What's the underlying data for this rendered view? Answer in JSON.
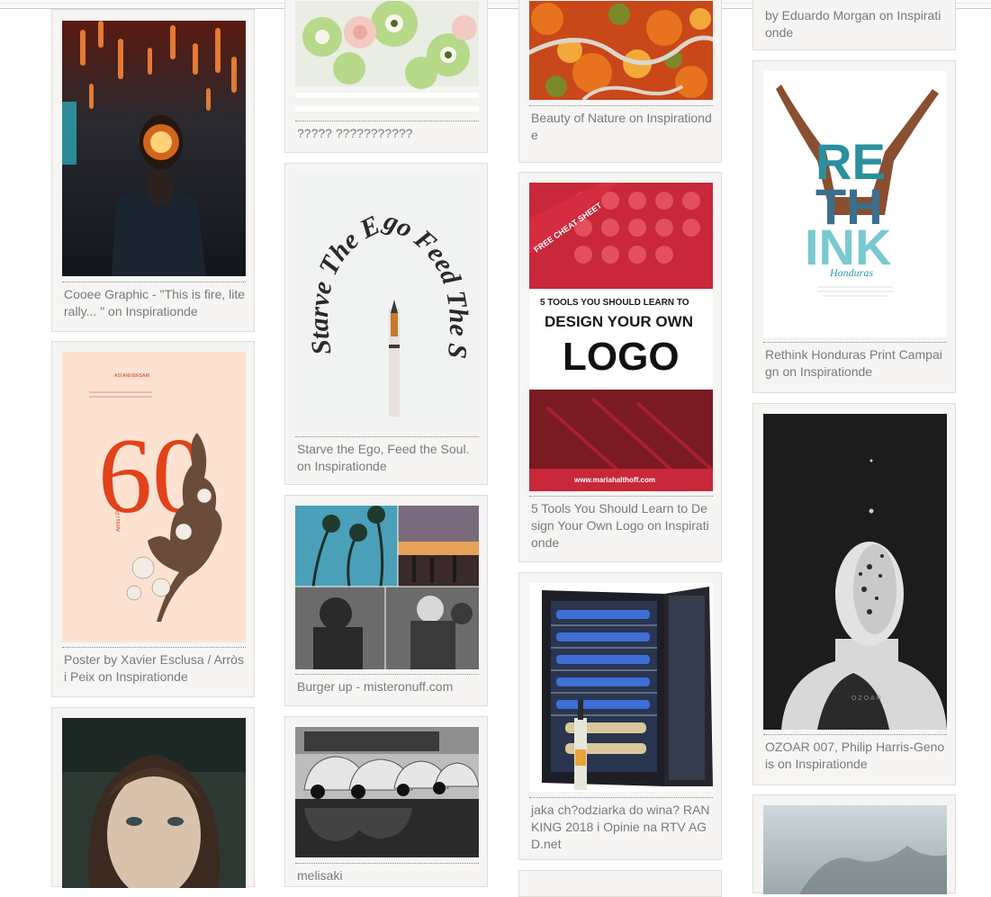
{
  "pins": {
    "c1": [
      {
        "caption": "Cooee Graphic - \"This is fire, literally... \" on Inspirationde"
      },
      {
        "caption": "Poster by Xavier Esclusa / Arròs i Peix on Inspirationde"
      },
      {
        "caption": ""
      }
    ],
    "c2": [
      {
        "caption": "????? ???????????"
      },
      {
        "caption": "Starve the Ego, Feed the Soul. on Inspirationde"
      },
      {
        "caption": "Burger up - misteronuff.com"
      },
      {
        "caption": "melisaki"
      }
    ],
    "c3": [
      {
        "caption": "Beauty of Nature on Inspirationde"
      },
      {
        "caption": "5 Tools You Should Learn to Design Your Own Logo on Inspirationde"
      },
      {
        "caption": "jaka ch?odziarka do wina? RANKING 2018 i Opinie na RTV AGD.net"
      }
    ],
    "c4": [
      {
        "caption": "by Eduardo Morgan on Inspirationde"
      },
      {
        "caption": "Rethink Honduras Print Campaign on Inspirationde"
      },
      {
        "caption": "OZOAR 007, Philip Harris-Genois on Inspirationde"
      }
    ]
  },
  "art": {
    "poster_number": "60",
    "poster_small_text": "ASÍ ANIVERSARI",
    "rethink_letters": [
      "RE",
      "TH",
      "INK"
    ],
    "rethink_word": "Honduras",
    "logo_banner": "FREE CHEAT SHEET",
    "logo_line1": "5 TOOLS YOU SHOULD LEARN TO",
    "logo_line2": "DESIGN YOUR OWN",
    "logo_line3": "LOGO",
    "logo_url": "www.mariahalthoff.com",
    "ozoar_label": "OZOAR",
    "calligraphy": "Starve The Ego Feed The Soul"
  },
  "colors": {
    "card_bg": "#f6f5f3",
    "caption": "#7a7a7a",
    "logo_red": "#c8283a"
  }
}
